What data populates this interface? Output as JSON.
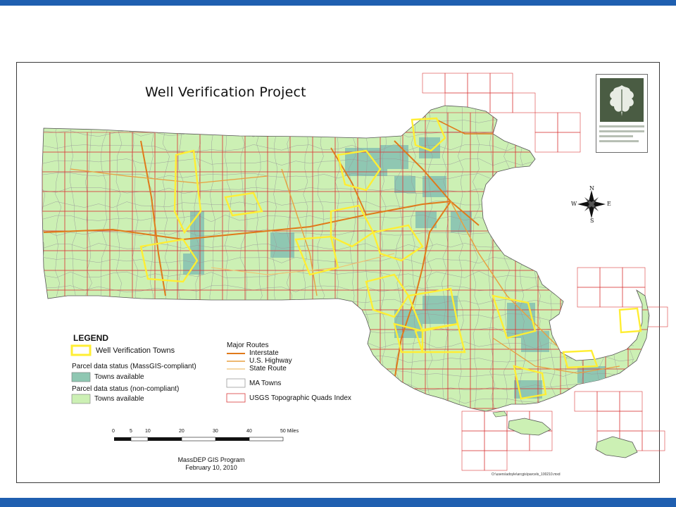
{
  "title": "Well Verification Project",
  "legend": {
    "heading": "LEGEND",
    "well_towns": "Well Verification Towns",
    "compliant_heading": "Parcel data status (MassGIS-compliant)",
    "compliant_item": "Towns available",
    "noncompliant_heading": "Parcel data status (non-compliant)",
    "noncompliant_item": "Towns available",
    "routes_heading": "Major Routes",
    "interstate": "Interstate",
    "us_highway": "U.S. Highway",
    "state_route": "State Route",
    "ma_towns": "MA Towns",
    "quads": "USGS Topographic Quads Index"
  },
  "scale": {
    "ticks": [
      "0",
      "5",
      "10",
      "20",
      "30",
      "40",
      "50 Miles"
    ]
  },
  "compass": {
    "n": "N",
    "s": "S",
    "e": "E",
    "w": "W"
  },
  "program": {
    "line1": "MassDEP GIS Program",
    "line2": "February 10, 2010"
  },
  "filepath": "O:\\users\\adoyle\\arcgis\\parcels_100210.mxd",
  "colors": {
    "brand_bar": "#1f5fb0",
    "well_outline": "#ffee33",
    "compliant_fill": "#8fc7b2",
    "noncompliant_fill": "#ccf0b4",
    "interstate": "#e07a1a",
    "us_highway": "#e8a040",
    "state_route": "#f0c070",
    "town_line": "#9a9a9a",
    "quad_line": "#d93a3a"
  }
}
